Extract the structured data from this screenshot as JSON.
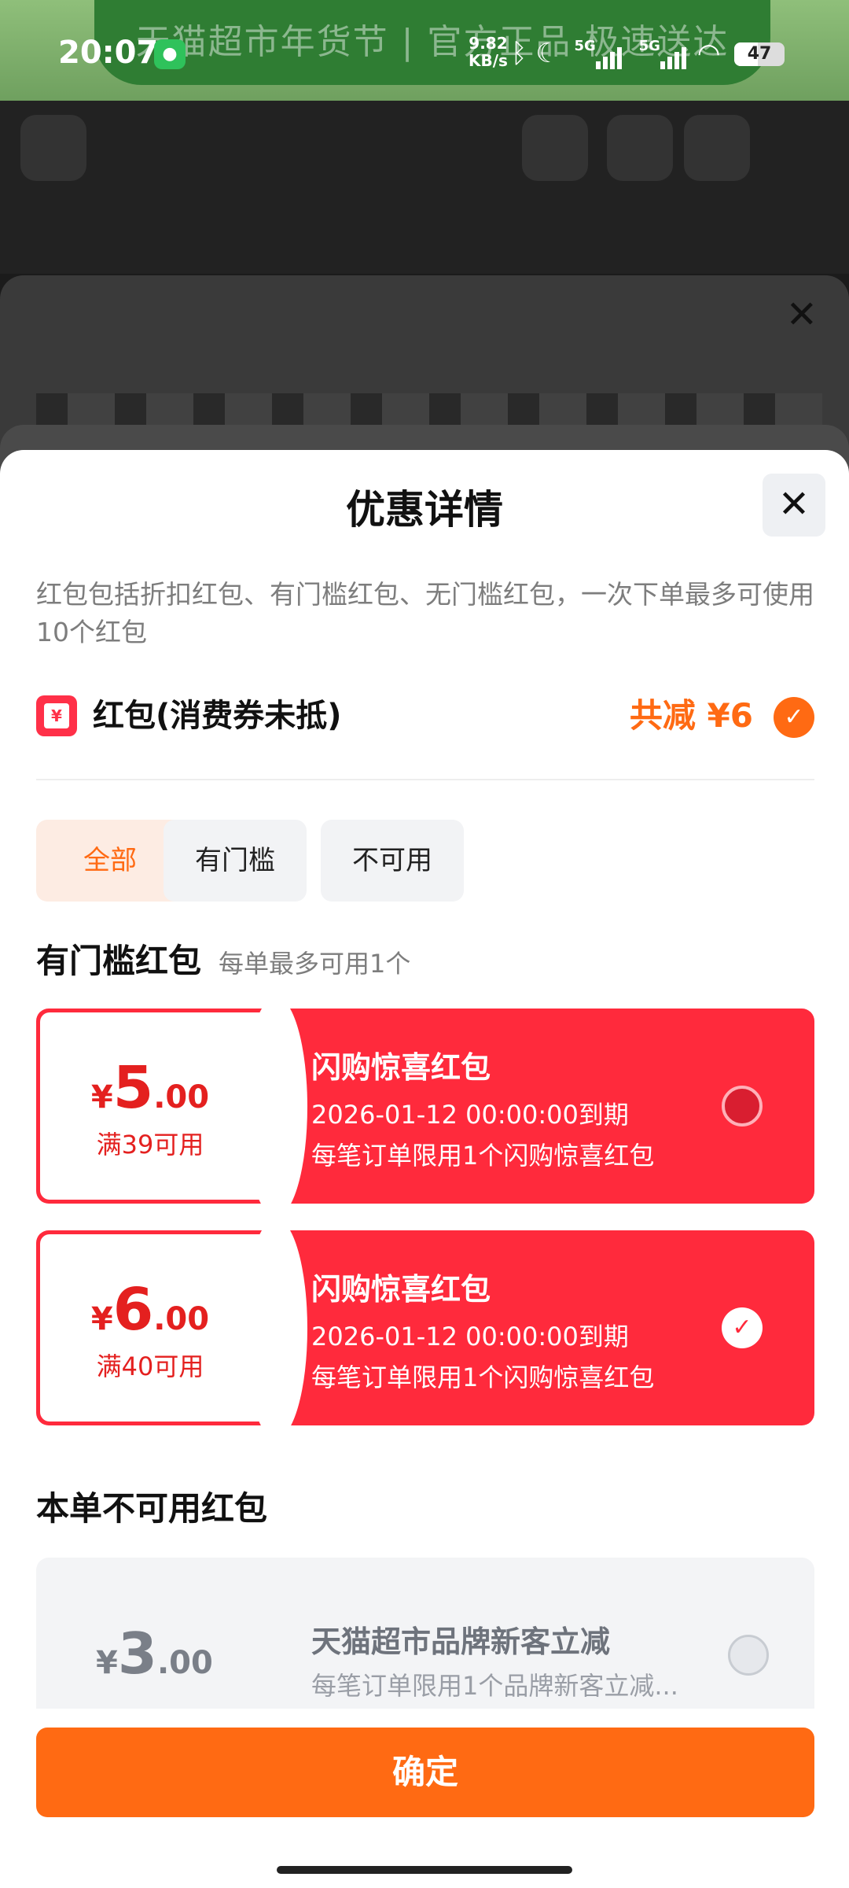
{
  "status_bar": {
    "time": "20:07",
    "net_speed_value": "9.82",
    "net_speed_unit": "KB/s",
    "battery": "47",
    "network_1": "5G",
    "network_2": "5G",
    "wechat_icon": "wechat-icon",
    "icons": [
      "bluetooth-icon",
      "moon-icon",
      "signal-icon",
      "signal-icon",
      "wifi-icon",
      "battery-icon"
    ]
  },
  "background": {
    "banner": "天猫超市年货节 | 官方正品 极速送达"
  },
  "modal": {
    "title": "优惠详情",
    "description": "红包包括折扣红包、有门槛红包、无门槛红包，一次下单最多可使用10个红包",
    "hongbao_label": "红包(消费券未抵)",
    "total_reduction": "共减 ¥6",
    "tabs": [
      {
        "label": "全部",
        "active": true
      },
      {
        "label": "有门槛",
        "active": false
      },
      {
        "label": "不可用",
        "active": false
      }
    ],
    "threshold_section": {
      "title": "有门槛红包",
      "subtitle": "每单最多可用1个"
    },
    "coupons": [
      {
        "currency": "¥",
        "amount_int": "5",
        "amount_dec": ".00",
        "condition": "满39可用",
        "name": "闪购惊喜红包",
        "expiry": "2026-01-12 00:00:00到期",
        "limit": "每笔订单限用1个闪购惊喜红包",
        "selected": false
      },
      {
        "currency": "¥",
        "amount_int": "6",
        "amount_dec": ".00",
        "condition": "满40可用",
        "name": "闪购惊喜红包",
        "expiry": "2026-01-12 00:00:00到期",
        "limit": "每笔订单限用1个闪购惊喜红包",
        "selected": true
      }
    ],
    "unavailable_section": {
      "title": "本单不可用红包"
    },
    "unavailable_coupons": [
      {
        "currency": "¥",
        "amount_int": "3",
        "amount_dec": ".00",
        "name": "天猫超市品牌新客立减",
        "limit": "每笔订单限用1个品牌新客立减..."
      }
    ],
    "confirm_label": "确定"
  },
  "colors": {
    "accent_orange": "#ff6a13",
    "coupon_red": "#ff2a3c",
    "amount_red": "#e4201f"
  }
}
